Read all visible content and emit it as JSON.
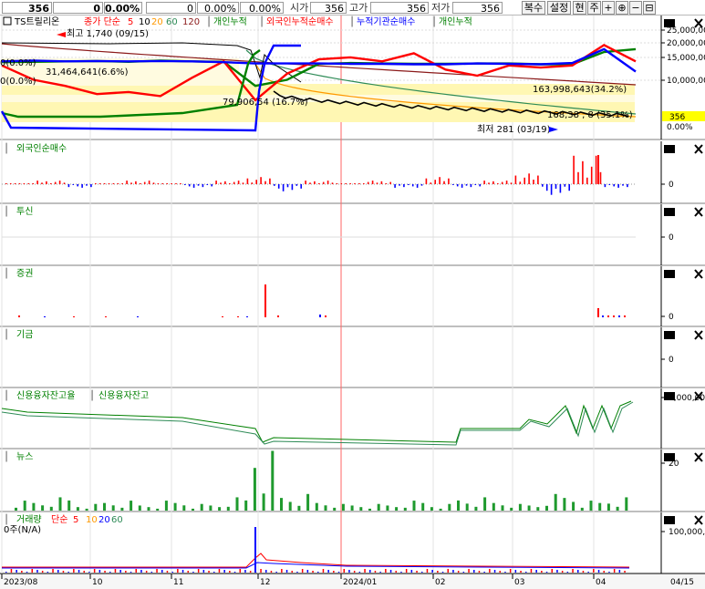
{
  "topbar": {
    "price": "356",
    "change": "0",
    "change_pct": "0.00%",
    "volume": "0",
    "vol_pct": "0.00%",
    "val_pct": "0.00%",
    "open_label": "시가",
    "open_value": "356",
    "high_label": "고가",
    "high_value": "356",
    "low_label": "저가",
    "low_value": "356",
    "buttons": [
      "복수",
      "설정",
      "현",
      "주"
    ]
  },
  "legend_main": {
    "stock_name": "TS트릴리온",
    "ma_label": "종가 단순",
    "ma_periods": [
      "5",
      "10",
      "20",
      "60",
      "120"
    ],
    "items": [
      "개인누적",
      "외국인누적순매수",
      "누적기관순매수",
      "개인누적"
    ]
  },
  "annotations": {
    "high": "최고 1,740 (09/15)",
    "low": "최저 281 (03/19)",
    "pct_a": "163,998,643(34.2%)",
    "pct_b": "79,906,54 (16.7%)",
    "pct_c": "31,464,641(6.6%)",
    "pct_d": "0(0.0%)",
    "pct_e": "0(0.0%)",
    "pct_f": "168,38 , 8 (35.1%)",
    "price_tag": "356",
    "pct_tag": "0.00%"
  },
  "panels": {
    "foreign": "외국인순매수",
    "trust": "투신",
    "securities": "증권",
    "pension": "기금",
    "credit": [
      "신용융자잔고율",
      "신용융자잔고"
    ],
    "news": "뉴스",
    "volume": [
      "거래량",
      "단순",
      "5",
      "10",
      "20",
      "60"
    ],
    "volume_sub": "0주(N/A)"
  },
  "axes": {
    "price_ticks": [
      "25,000,00",
      "20,000,00",
      "15,000,00",
      "10,000,00"
    ],
    "zero": "0",
    "credit_tick": "1,000,00",
    "news_tick": "20",
    "volume_tick": "100,000,0",
    "dates": [
      "2023/08",
      "10",
      "11",
      "12",
      "2024/01",
      "02",
      "03",
      "04",
      "04/15"
    ]
  },
  "colors": {
    "red": "#ff0000",
    "blue": "#0000ff",
    "green": "#008000",
    "dark_red": "#8b1a1a",
    "orange": "#ff9900",
    "band": "#fff7b3",
    "cursor": "#ff6666"
  },
  "chart_data": [
    {
      "type": "line",
      "title": "TS트릴리온",
      "note": "price with moving averages and cumulative investor lines",
      "series": [
        {
          "name": "개인누적",
          "values": [
            17.8,
            17.9,
            18.0,
            18.1,
            17.9,
            18.2,
            18.0,
            17.9,
            12.0,
            13.5,
            17.4,
            17.6,
            17.5,
            17.4,
            17.4,
            17.5,
            17.5,
            17.3,
            17.3,
            20.3,
            21.0
          ]
        },
        {
          "name": "외국인누적순매수",
          "values": [
            17.0,
            13.5,
            12.0,
            10.0,
            10.5,
            9.5,
            14.0,
            18.0,
            8.5,
            15.0,
            18.5,
            19.0,
            18.0,
            20.0,
            16.0,
            14.5,
            17.0,
            16.5,
            17.0,
            22.0,
            18.0
          ]
        },
        {
          "name": "누적기관순매수",
          "values": [
            18.0,
            18.2,
            18.0,
            18.1,
            18.0,
            18.1,
            18.0,
            17.8,
            17.5,
            17.5,
            17.5,
            17.4,
            17.4,
            17.3,
            17.3,
            17.5,
            17.4,
            17.3,
            17.6,
            21.0,
            15.5
          ]
        }
      ],
      "ylim": [
        0,
        27
      ]
    },
    {
      "type": "bar",
      "title": "외국인순매수",
      "values": [
        0,
        1,
        -1,
        0,
        1,
        0,
        -1,
        1,
        2,
        -2,
        1,
        0,
        1,
        -1,
        2,
        -1,
        1,
        3,
        -3,
        8,
        -1
      ]
    },
    {
      "type": "bar",
      "title": "뉴스",
      "values": [
        3,
        4,
        2,
        3,
        2,
        3,
        2,
        4,
        18,
        5,
        3,
        2,
        2,
        3,
        2,
        4,
        3,
        2,
        5,
        3,
        4
      ]
    }
  ]
}
